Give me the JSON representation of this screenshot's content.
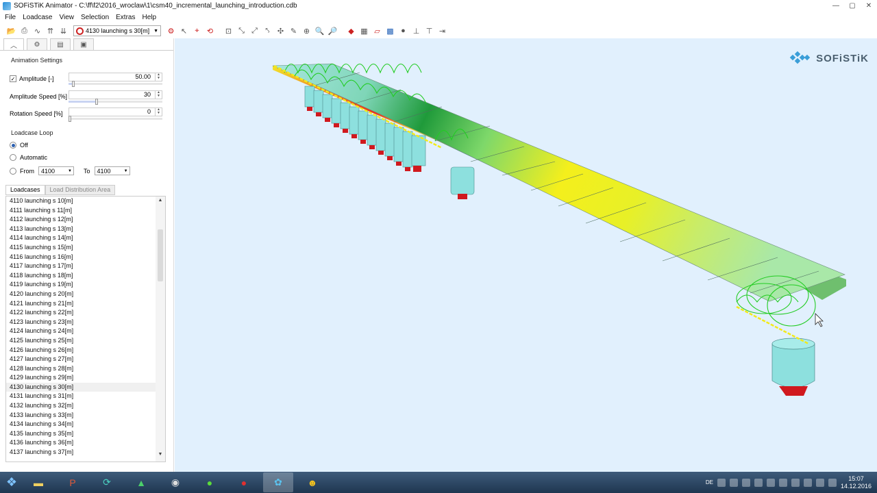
{
  "window": {
    "title": "SOFiSTiK Animator - C:\\ff\\f2\\2016_wroclaw\\1\\csm40_incremental_launching_introduction.cdb",
    "controls": [
      "—",
      "▢",
      "✕"
    ]
  },
  "menu": [
    "File",
    "Loadcase",
    "View",
    "Selection",
    "Extras",
    "Help"
  ],
  "toolbar": {
    "loadcase_select": "4130 launching s 30[m]"
  },
  "animation_settings": {
    "title": "Animation Settings",
    "amplitude_label": "Amplitude [-]",
    "amplitude_checked": "✓",
    "amplitude_value": "50.00",
    "amplitude_level": 0.05,
    "amplitude_speed_label": "Amplitude Speed [%]",
    "amplitude_speed_value": "30",
    "amplitude_speed_level": 0.3,
    "rotation_speed_label": "Rotation Speed [%]",
    "rotation_speed_value": "0",
    "rotation_speed_level": 0.0
  },
  "loadcase_loop": {
    "title": "Loadcase Loop",
    "off_label": "Off",
    "automatic_label": "Automatic",
    "from_label": "From",
    "from_value": "4100",
    "to_label": "To",
    "to_value": "4100",
    "selected": "Off"
  },
  "list_tabs": [
    "Loadcases",
    "Load Distribution Area"
  ],
  "loadcases": [
    "4110 launching s 10[m]",
    "4111 launching s 11[m]",
    "4112 launching s 12[m]",
    "4113 launching s 13[m]",
    "4114 launching s 14[m]",
    "4115 launching s 15[m]",
    "4116 launching s 16[m]",
    "4117 launching s 17[m]",
    "4118 launching s 18[m]",
    "4119 launching s 19[m]",
    "4120 launching s 20[m]",
    "4121 launching s 21[m]",
    "4122 launching s 22[m]",
    "4123 launching s 23[m]",
    "4124 launching s 24[m]",
    "4125 launching s 25[m]",
    "4126 launching s 26[m]",
    "4127 launching s 27[m]",
    "4128 launching s 28[m]",
    "4129 launching s 29[m]",
    "4130 launching s 30[m]",
    "4131 launching s 31[m]",
    "4132 launching s 32[m]",
    "4133 launching s 33[m]",
    "4134 launching s 34[m]",
    "4135 launching s 35[m]",
    "4136 launching s 36[m]",
    "4137 launching s 37[m]"
  ],
  "selected_loadcase": "4130 launching s 30[m]",
  "viewport": {
    "logo_text": "SOFiSTiK",
    "background": "#e1f0fd"
  },
  "taskbar": {
    "language": "DE",
    "time": "15:07",
    "date": "14.12.2016"
  },
  "colors": {
    "accent": "#2563b8",
    "selection": "#f0f0f0",
    "support_red": "#d0191e",
    "support_cyan": "#8de0de",
    "load_green": "#22cc22"
  }
}
